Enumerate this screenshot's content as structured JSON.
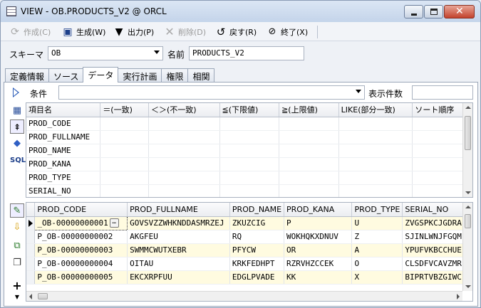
{
  "window": {
    "title": "VIEW - OB.PRODUCTS_V2 @ ORCL"
  },
  "toolbar": {
    "create": "作成(C)",
    "generate": "生成(W)",
    "output": "出力(P)",
    "delete": "削除(D)",
    "back": "戻す(R)",
    "finish": "終了(X)"
  },
  "schema": {
    "label": "スキーマ",
    "value": "OB",
    "name_label": "名前",
    "name_value": "PRODUCTS_V2"
  },
  "tabs": [
    {
      "label": "定義情報"
    },
    {
      "label": "ソース"
    },
    {
      "label": "データ"
    },
    {
      "label": "実行計画"
    },
    {
      "label": "権限"
    },
    {
      "label": "相関"
    }
  ],
  "condition": {
    "label": "条件",
    "value": "",
    "count_label": "表示件数",
    "count_value": ""
  },
  "cond_grid": {
    "headers": [
      "項目名",
      "＝(一致)",
      "＜＞(不一致)",
      "≦(下限値)",
      "≧(上限値)",
      "LIKE(部分一致)",
      "ソート順序"
    ],
    "rows": [
      "PROD_CODE",
      "PROD_FULLNAME",
      "PROD_NAME",
      "PROD_KANA",
      "PROD_TYPE",
      "SERIAL_NO"
    ]
  },
  "result_grid": {
    "headers": [
      "PROD_CODE",
      "PROD_FULLNAME",
      "PROD_NAME",
      "PROD_KANA",
      "PROD_TYPE",
      "SERIAL_NO"
    ],
    "rows": [
      [
        "_OB-00000000001",
        "GOVSVZZWHKNDDASMRZEJ",
        "ZKUZCIG",
        "P",
        "U",
        "ZVGSPKCJGDRA"
      ],
      [
        "P_OB-00000000002",
        "AKGFEU",
        "RQ",
        "WOKHQKXDNUV",
        "Z",
        "SJINLWNJFGQM"
      ],
      [
        "P_OB-00000000003",
        "SWMMCWUTXEBR",
        "PFYCW",
        "OR",
        "A",
        "YPUFVKBCCHUE"
      ],
      [
        "P_OB-00000000004",
        "OITAU",
        "KRKFEDHPT",
        "RZRVHZCCEK",
        "O",
        "CLSDFVCAVZMR"
      ],
      [
        "P_OB-00000000005",
        "EKCXRPFUU",
        "EDGLPVADE",
        "KK",
        "X",
        "BIPRTVBZGIWC"
      ]
    ]
  },
  "icons": {
    "sql_label": "SQL"
  }
}
